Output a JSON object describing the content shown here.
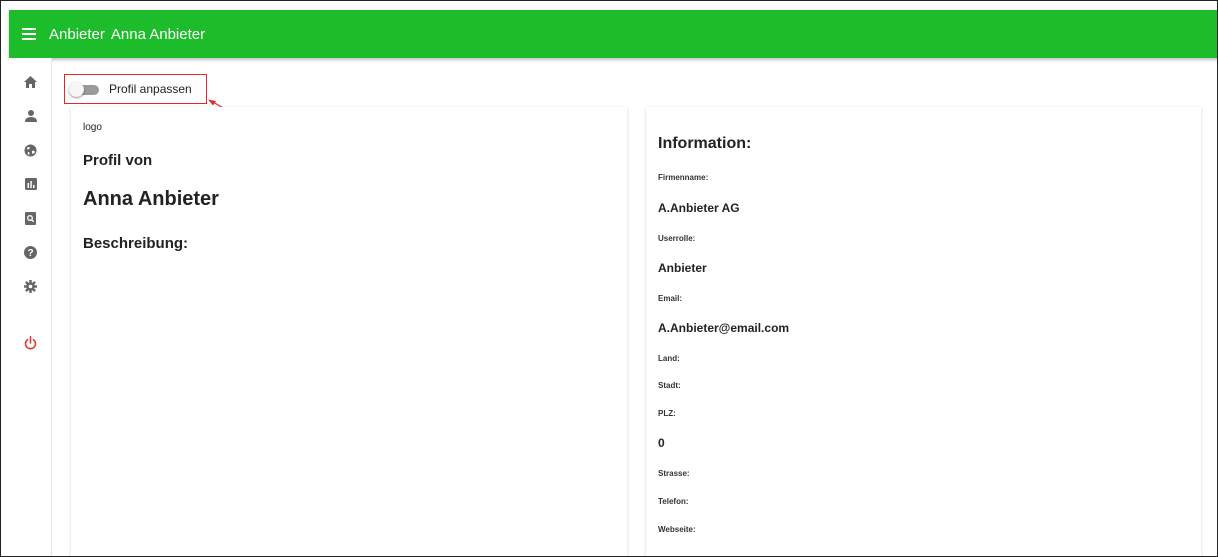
{
  "header": {
    "app_name": "Anbieter",
    "user_name": "Anna Anbieter",
    "bg_color": "#1cbc2b"
  },
  "sidebar": {
    "items": [
      {
        "icon": "home-icon"
      },
      {
        "icon": "person-icon"
      },
      {
        "icon": "globe-icon"
      },
      {
        "icon": "bar-chart-icon"
      },
      {
        "icon": "document-search-icon"
      },
      {
        "icon": "help-icon"
      },
      {
        "icon": "settings-icon"
      },
      {
        "icon": "power-icon",
        "color": "#e53935"
      }
    ]
  },
  "toggle": {
    "label": "Profil anpassen",
    "checked": false,
    "highlight_color": "#e02a2a"
  },
  "profile": {
    "logo_text": "logo",
    "profile_of_label": "Profil von",
    "name": "Anna Anbieter",
    "description_label": "Beschreibung:"
  },
  "information": {
    "title": "Information:",
    "fields": [
      {
        "label": "Firmenname:",
        "value": "A.Anbieter AG"
      },
      {
        "label": "Userrolle:",
        "value": "Anbieter"
      },
      {
        "label": "Email:",
        "value": "A.Anbieter@email.com"
      },
      {
        "label": "Land:",
        "value": ""
      },
      {
        "label": "Stadt:",
        "value": ""
      },
      {
        "label": "PLZ:",
        "value": "0"
      },
      {
        "label": "Strasse:",
        "value": ""
      },
      {
        "label": "Telefon:",
        "value": ""
      },
      {
        "label": "Webseite:",
        "value": ""
      }
    ]
  }
}
